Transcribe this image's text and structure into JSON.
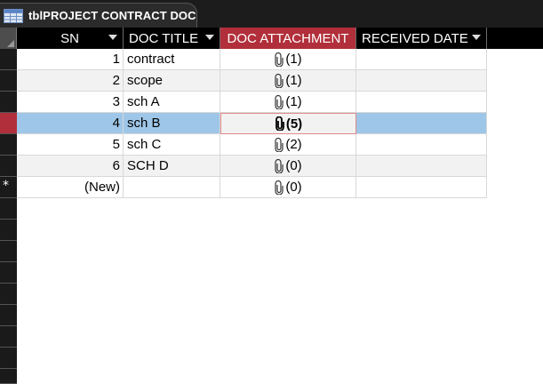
{
  "tab": {
    "title": "tblPROJECT CONTRACT DOC",
    "icon": "table-icon"
  },
  "columns": [
    {
      "label": "SN",
      "has_dropdown": true
    },
    {
      "label": "DOC TITLE",
      "has_dropdown": true
    },
    {
      "label": "DOC ATTACHMENT",
      "has_dropdown": false,
      "active": true
    },
    {
      "label": "RECEIVED DATE",
      "has_dropdown": true
    }
  ],
  "rows": [
    {
      "sn": "1",
      "title": "contract",
      "attachments": "(1)",
      "received": ""
    },
    {
      "sn": "2",
      "title": "scope",
      "attachments": "(1)",
      "received": ""
    },
    {
      "sn": "3",
      "title": "sch A",
      "attachments": "(1)",
      "received": ""
    },
    {
      "sn": "4",
      "title": "sch B",
      "attachments": "(5)",
      "received": "",
      "selected": true
    },
    {
      "sn": "5",
      "title": "sch C",
      "attachments": "(2)",
      "received": ""
    },
    {
      "sn": "6",
      "title": "SCH D",
      "attachments": "(0)",
      "received": ""
    }
  ],
  "new_row": {
    "sn": "(New)",
    "attachments": "(0)",
    "marker": "*"
  },
  "icons": {
    "attachment": "paperclip-icon",
    "dropdown": "chevron-down-icon"
  },
  "colors": {
    "active_header": "#b12f3a",
    "selected_row": "#9ec6e8",
    "alt_row": "#f2f2f2"
  }
}
